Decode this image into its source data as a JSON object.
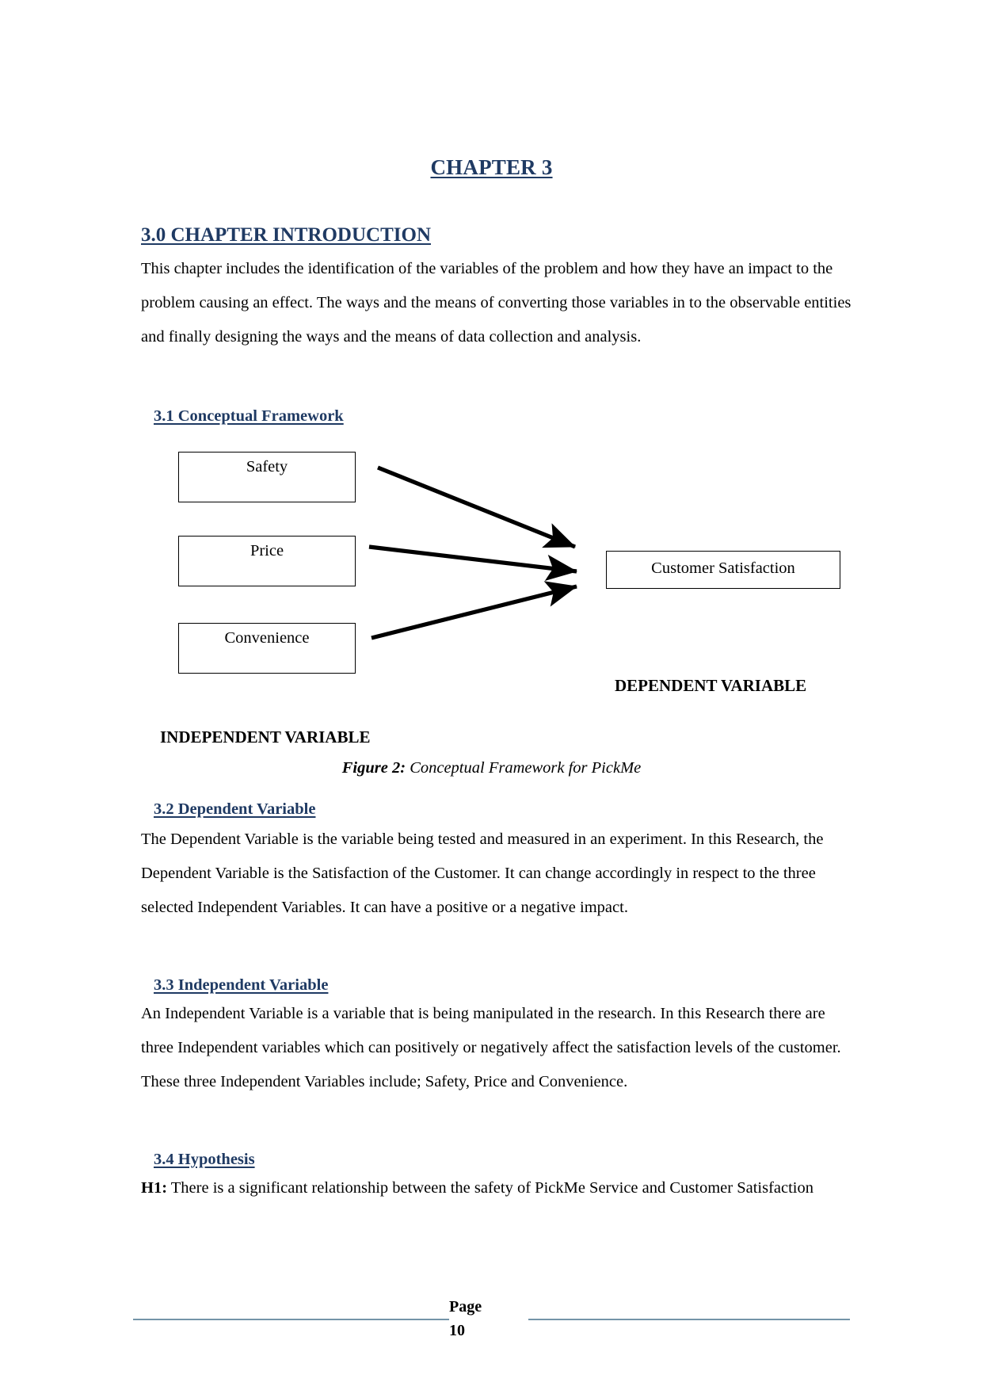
{
  "document": {
    "chapter_title": "CHAPTER 3",
    "heading_color": "#1F3A63",
    "body_color": "#000000",
    "footer_rule_color": "#7494A8"
  },
  "sections": {
    "intro": {
      "heading": "3.0 CHAPTER INTRODUCTION ",
      "body": "This chapter includes the identification of the variables of the problem and how they have an impact to the problem causing an effect. The ways and the means of converting those variables in to the observable entities and finally designing the ways and the means of data collection and analysis."
    },
    "conceptual_framework": {
      "heading": "3.1 Conceptual Framework"
    },
    "dependent_variable": {
      "heading": "3.2 Dependent Variable",
      "body": "The Dependent Variable is the variable being tested and measured in an experiment. In this Research, the Dependent Variable is the Satisfaction of the Customer.  It can change accordingly in respect to the three selected Independent Variables. It can have a positive or a negative impact."
    },
    "independent_variable": {
      "heading": "3.3 Independent Variable",
      "body": "An Independent Variable is a variable that is being manipulated in the research. In this Research there are three Independent variables which can positively or negatively affect the satisfaction levels of the customer. These three Independent Variables include; Safety, Price and Convenience."
    },
    "hypothesis": {
      "heading": "3.4 Hypothesis",
      "label": "H1:",
      "body": " There is a significant relationship between the safety of PickMe Service and Customer Satisfaction"
    }
  },
  "diagram": {
    "independent_boxes": [
      {
        "label": "Safety"
      },
      {
        "label": "Price"
      },
      {
        "label": "Convenience"
      }
    ],
    "dependent_box": {
      "label": "Customer Satisfaction"
    },
    "independent_group_label": "INDEPENDENT VARIABLE",
    "dependent_group_label": "DEPENDENT VARIABLE",
    "arrow_count": 3,
    "arrow_color": "#000000"
  },
  "figure": {
    "number": "Figure 2:",
    "caption": " Conceptual Framework for PickMe"
  },
  "footer": {
    "page_word": "Page",
    "page_number": "10"
  }
}
